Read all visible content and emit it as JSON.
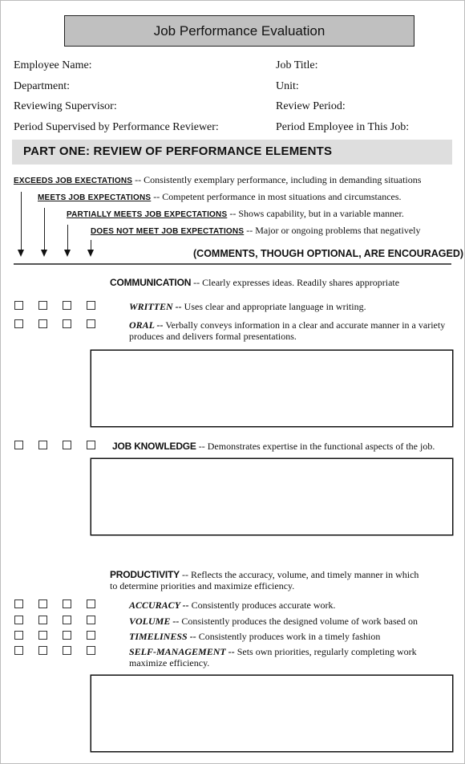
{
  "document": {
    "title": "Job Performance Evaluation",
    "fields_left": [
      "Employee Name:",
      "Department:",
      "Reviewing Supervisor:",
      "Period Supervised by Performance Reviewer:"
    ],
    "fields_right": [
      "Job Title:",
      "Unit:",
      "Review Period:",
      "Period Employee in This Job:"
    ]
  },
  "part_one": {
    "title": "PART ONE: REVIEW OF PERFORMANCE ELEMENTS",
    "legend": [
      {
        "key": "EXCEEDS JOB EXECTATIONS",
        "desc": " -- Consistently exemplary performance, including in demanding situations"
      },
      {
        "key": "MEETS JOB EXPECTATIONS",
        "desc": " -- Competent performance in most situations and circumstances."
      },
      {
        "key": "PARTIALLY MEETS JOB EXPECTATIONS",
        "desc": " -- Shows capability, but in a variable manner."
      },
      {
        "key": "DOES NOT MEET JOB EXPECTATIONS",
        "desc": " -- Major or ongoing problems that negatively"
      }
    ],
    "comments_note": "(COMMENTS, THOUGH OPTIONAL, ARE ENCOURAGED)"
  },
  "categories": {
    "communication": {
      "key": "COMMUNICATION",
      "desc": " -- Clearly expresses ideas.  Readily shares appropriate",
      "items": [
        {
          "key": "WRITTEN --",
          "desc": " Uses clear and appropriate language in writing."
        },
        {
          "key": "ORAL --",
          "desc": " Verbally conveys information in a clear and accurate manner in a variety produces and delivers formal presentations."
        }
      ]
    },
    "job_knowledge": {
      "key": "JOB KNOWLEDGE",
      "desc": " -- Demonstrates expertise in the functional aspects of the job."
    },
    "productivity": {
      "key": "PRODUCTIVITY",
      "desc": " -- Reflects the accuracy, volume, and timely manner in which",
      "desc2": "to determine priorities and maximize efficiency.",
      "items": [
        {
          "key": "ACCURACY --",
          "desc": " Consistently produces accurate work."
        },
        {
          "key": "VOLUME --",
          "desc": " Consistently produces the designed volume of work based on"
        },
        {
          "key": "TIMELINESS --",
          "desc": " Consistently produces work in a timely fashion"
        },
        {
          "key": "SELF-MANAGEMENT --",
          "desc": " Sets own priorities, regularly completing work maximize efficiency."
        }
      ]
    }
  }
}
